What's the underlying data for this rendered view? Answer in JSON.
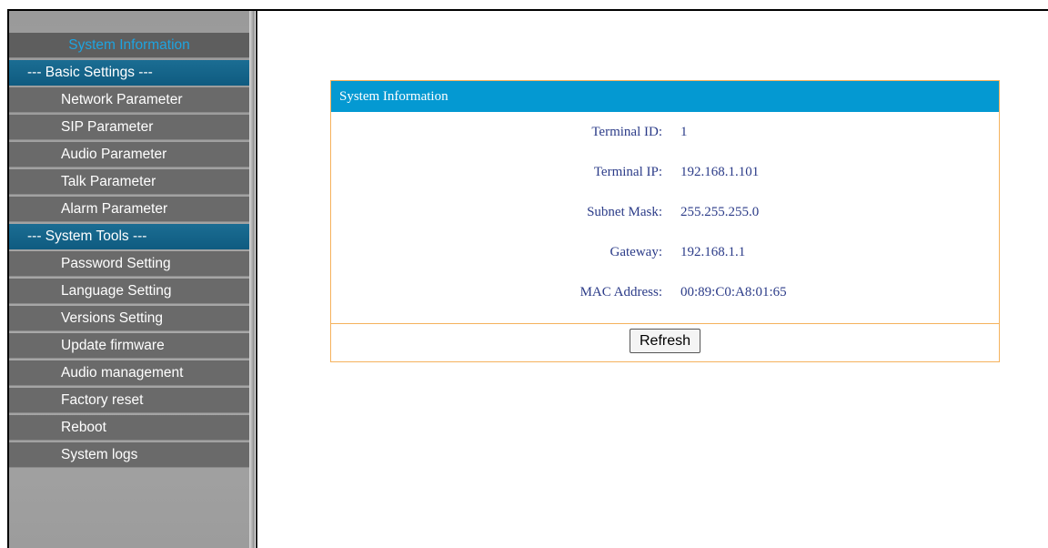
{
  "sidebar": {
    "active_item": "System Information",
    "sections": [
      {
        "title": "--- Basic Settings ---",
        "items": [
          "Network Parameter",
          "SIP Parameter",
          "Audio Parameter",
          "Talk Parameter",
          "Alarm Parameter"
        ]
      },
      {
        "title": "--- System Tools ---",
        "items": [
          "Password Setting",
          "Language Setting",
          "Versions Setting",
          "Update firmware",
          "Audio management",
          "Factory reset",
          "Reboot",
          "System logs"
        ]
      }
    ]
  },
  "panel": {
    "title": "System Information",
    "rows": [
      {
        "label": "Terminal ID:",
        "value": "1"
      },
      {
        "label": "Terminal IP:",
        "value": "192.168.1.101"
      },
      {
        "label": "Subnet Mask:",
        "value": "255.255.255.0"
      },
      {
        "label": "Gateway:",
        "value": "192.168.1.1"
      },
      {
        "label": "MAC Address:",
        "value": "00:89:C0:A8:01:65"
      }
    ],
    "refresh_label": "Refresh"
  },
  "colors": {
    "accent": "#0499d2",
    "active_text": "#1ea4e0",
    "panel_border": "#f5b25c",
    "section_bg": "#0f5b80"
  }
}
